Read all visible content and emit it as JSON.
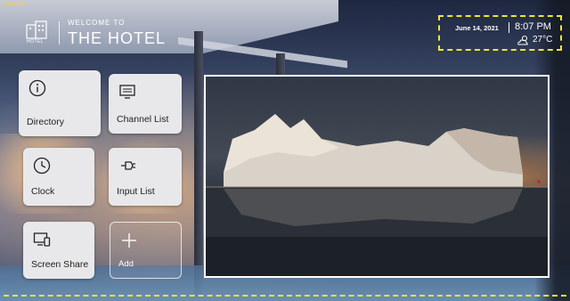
{
  "corner_label": "H0002036",
  "header": {
    "logo_text": "HOTEL",
    "welcome": "WELCOME TO",
    "hotel_name": "THE HOTEL"
  },
  "status": {
    "date": "June 14, 2021",
    "time": "8:07 PM",
    "weather_icon": "partly-cloudy-icon",
    "temperature": "27°C"
  },
  "tiles": [
    {
      "label": "Directory",
      "icon": "info-icon"
    },
    {
      "label": "Channel List",
      "icon": "tv-icon"
    },
    {
      "label": "Clock",
      "icon": "clock-icon"
    },
    {
      "label": "Input List",
      "icon": "input-plug-icon"
    },
    {
      "label": "Screen Share",
      "icon": "screen-share-icon"
    },
    {
      "label": "Add",
      "icon": "plus-icon"
    }
  ],
  "colors": {
    "highlight_dash": "#f1e33b",
    "tile_bg": "#e8e8ea",
    "text_light": "#ffffff"
  }
}
